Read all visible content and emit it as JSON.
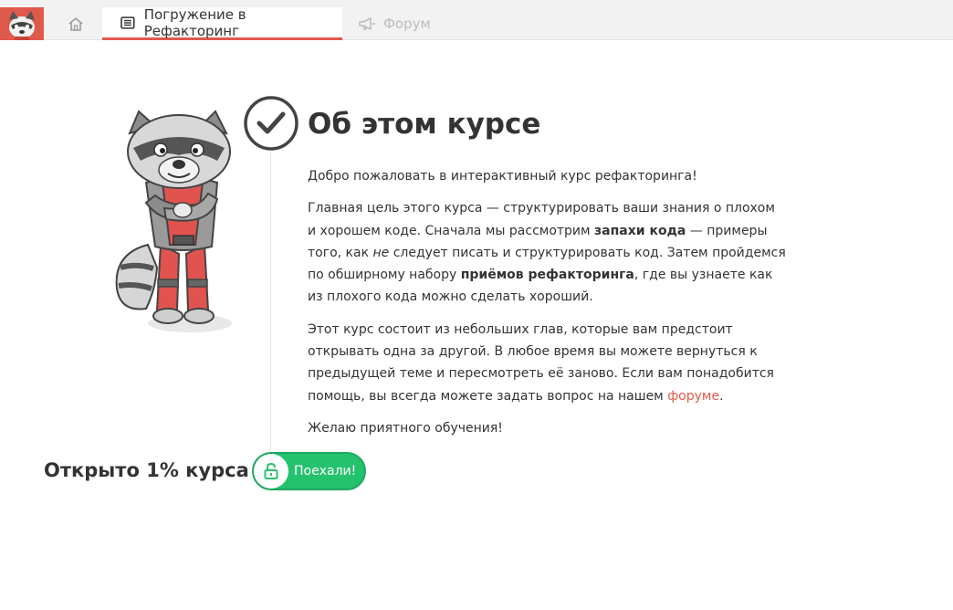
{
  "nav": {
    "logo": "raccoon-logo",
    "home_icon": "home-icon",
    "tabs": [
      {
        "label": "Погружение в Рефакторинг",
        "icon": "book-icon",
        "active": true
      },
      {
        "label": "Форум",
        "icon": "megaphone-icon",
        "active": false
      }
    ],
    "accent_color": "#e05a4c"
  },
  "main": {
    "title": "Об этом курсе",
    "intro": "Добро пожаловать в интерактивный курс рефакторинга!",
    "p2": {
      "a": "Главная цель этого курса — структурировать ваши знания о плохом и хорошем коде. Сначала мы рассмотрим ",
      "b": "запахи кода",
      "c": " — примеры того, как ",
      "d": "не",
      "e": " следует писать и структурировать код. Затем пройдемся по обширному набору ",
      "f": "приёмов рефакторинга",
      "g": ", где вы узнаете как из плохого кода можно сделать хороший."
    },
    "p3": {
      "a": "Этот курс состоит из небольших глав, которые вам предстоит открывать одна за другой. В любое время вы можете вернуться к предыдущей теме и пересмотреть её заново. Если вам понадобится помощь, вы всегда можете задать вопрос на нашем ",
      "link": "форуме",
      "b": "."
    },
    "closing": "Желаю приятного обучения!"
  },
  "progress": {
    "label": "Открыто 1% курса",
    "percent": 1
  },
  "start_button": {
    "label": "Поехали!",
    "icon": "unlock-icon",
    "color": "#25c26e"
  }
}
